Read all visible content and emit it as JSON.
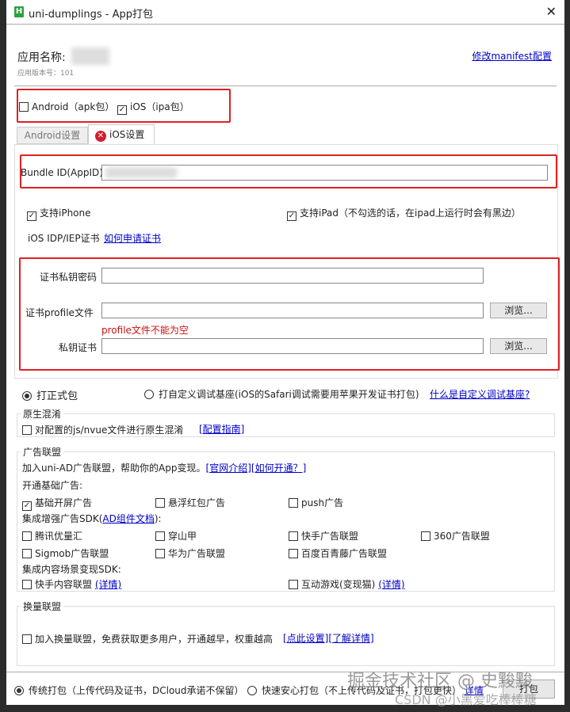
{
  "window": {
    "title": "uni-dumplings - App打包",
    "close": "✕"
  },
  "header": {
    "app_name_label": "应用名称:",
    "version": "应用版本号：101",
    "manifest_link": "修改manifest配置"
  },
  "platforms": {
    "android": "Android（apk包）",
    "android_checked": false,
    "ios": "iOS（ipa包）",
    "ios_checked": true
  },
  "tabs": [
    {
      "label": "Android设置"
    },
    {
      "label": "iOS设置"
    }
  ],
  "ios": {
    "bundle_label": "Bundle ID(AppID)",
    "bundle_value": "",
    "iphone": "支持iPhone",
    "ipad": "支持iPad（不勾选的话，在ipad上运行时会有黑边）",
    "cert_label": "iOS IDP/IEP证书",
    "cert_link": "如何申请证书",
    "pwd_label": "证书私钥密码",
    "profile_label": "证书profile文件",
    "profile_error": "profile文件不能为空",
    "key_label": "私钥证书",
    "browse": "浏览..."
  },
  "build_type": {
    "formal": "打正式包",
    "custom": "打自定义调试基座(iOS的Safari调试需要用苹果开发证书打包)",
    "custom_link": "什么是自定义调试基座?"
  },
  "obfuscation": {
    "title": "原生混淆",
    "option": "对配置的js/nvue文件进行原生混淆",
    "link": "[配置指南]"
  },
  "ads": {
    "title": "广告联盟",
    "intro": "加入uni-AD广告联盟，帮助你的App变现。",
    "link1": "[官网介绍]",
    "link2": "[如何开通？]",
    "basic_title": "开通基础广告:",
    "basic": [
      "基础开屏广告",
      "悬浮红包广告",
      "push广告"
    ],
    "sdk_title_pre": "集成增强广告SDK(",
    "sdk_link": "AD组件文档",
    "sdk_title_post": "):",
    "sdk": [
      "腾讯优量汇",
      "穿山甲",
      "快手广告联盟",
      "360广告联盟",
      "Sigmob广告联盟",
      "华为广告联盟",
      "百度百青藤广告联盟"
    ],
    "content_title": "集成内容场景变现SDK:",
    "content": [
      "快手内容联盟",
      "互动游戏(变现猫)"
    ],
    "detail": "(详情)"
  },
  "exchange": {
    "title": "换量联盟",
    "option": "加入换量联盟，免费获取更多用户，开通越早，权重越高",
    "link1": "[点此设置]",
    "link2": "[了解详情]"
  },
  "footer": {
    "traditional": "传统打包（上传代码及证书，DCloud承诺不保留）",
    "fast": "快速安心打包（不上传代码及证书，打包更快）",
    "fast_link": "详情",
    "pack": "打包"
  },
  "watermark": {
    "line1": "掘金技术社区 @ 史黢黢",
    "line2": "CSDN @小黑爱吃棒棒糖"
  }
}
